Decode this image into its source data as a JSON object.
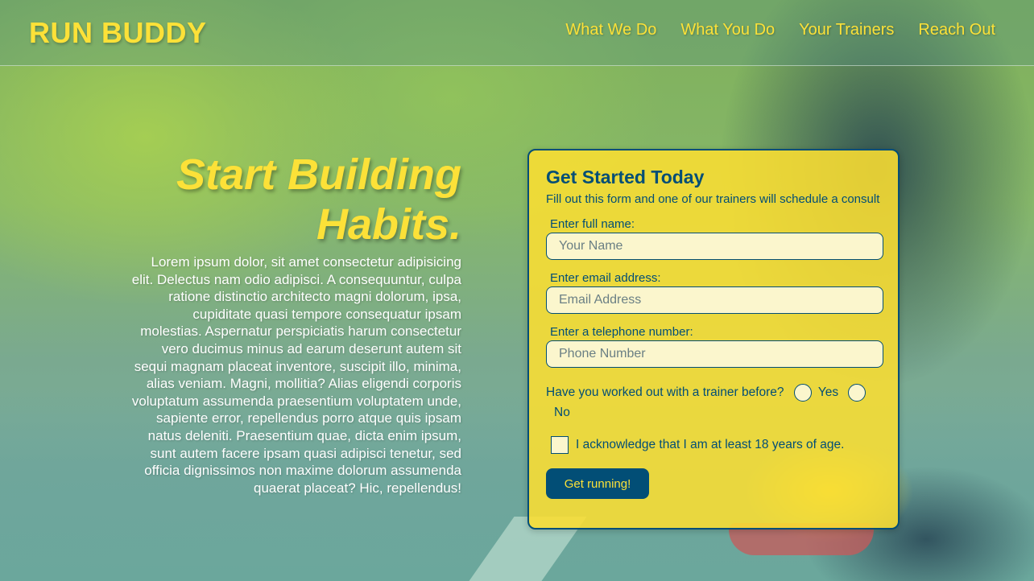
{
  "header": {
    "logo": "RUN BUDDY",
    "nav": [
      "What We Do",
      "What You Do",
      "Your Trainers",
      "Reach Out"
    ]
  },
  "hero": {
    "title_line1": "Start Building",
    "title_line2": "Habits.",
    "body": "Lorem ipsum dolor, sit amet consectetur adipisicing elit. Delectus nam odio adipisci. A consequuntur, culpa ratione distinctio architecto magni dolorum, ipsa, cupiditate quasi tempore consequatur ipsam molestias. Aspernatur perspiciatis harum consectetur vero ducimus minus ad earum deserunt autem sit sequi magnam placeat inventore, suscipit illo, minima, alias veniam. Magni, mollitia? Alias eligendi corporis voluptatum assumenda praesentium voluptatem unde, sapiente error, repellendus porro atque quis ipsam natus deleniti. Praesentium quae, dicta enim ipsum, sunt autem facere ipsam quasi adipisci tenetur, sed officia dignissimos non maxime dolorum assumenda quaerat placeat? Hic, repellendus!"
  },
  "form": {
    "heading": "Get Started Today",
    "subheading": "Fill out this form and one of our trainers will schedule a consult",
    "name_label": "Enter full name:",
    "name_placeholder": "Your Name",
    "email_label": "Enter email address:",
    "email_placeholder": "Email Address",
    "phone_label": "Enter a telephone number:",
    "phone_placeholder": "Phone Number",
    "trainer_question": "Have you worked out with a trainer before?",
    "yes_label": "Yes",
    "no_label": "No",
    "acknowledge": "I acknowledge that I am at least 18 years of age.",
    "submit_label": "Get running!"
  },
  "colors": {
    "accent_yellow": "#fce138",
    "primary_blue": "#024e76"
  }
}
